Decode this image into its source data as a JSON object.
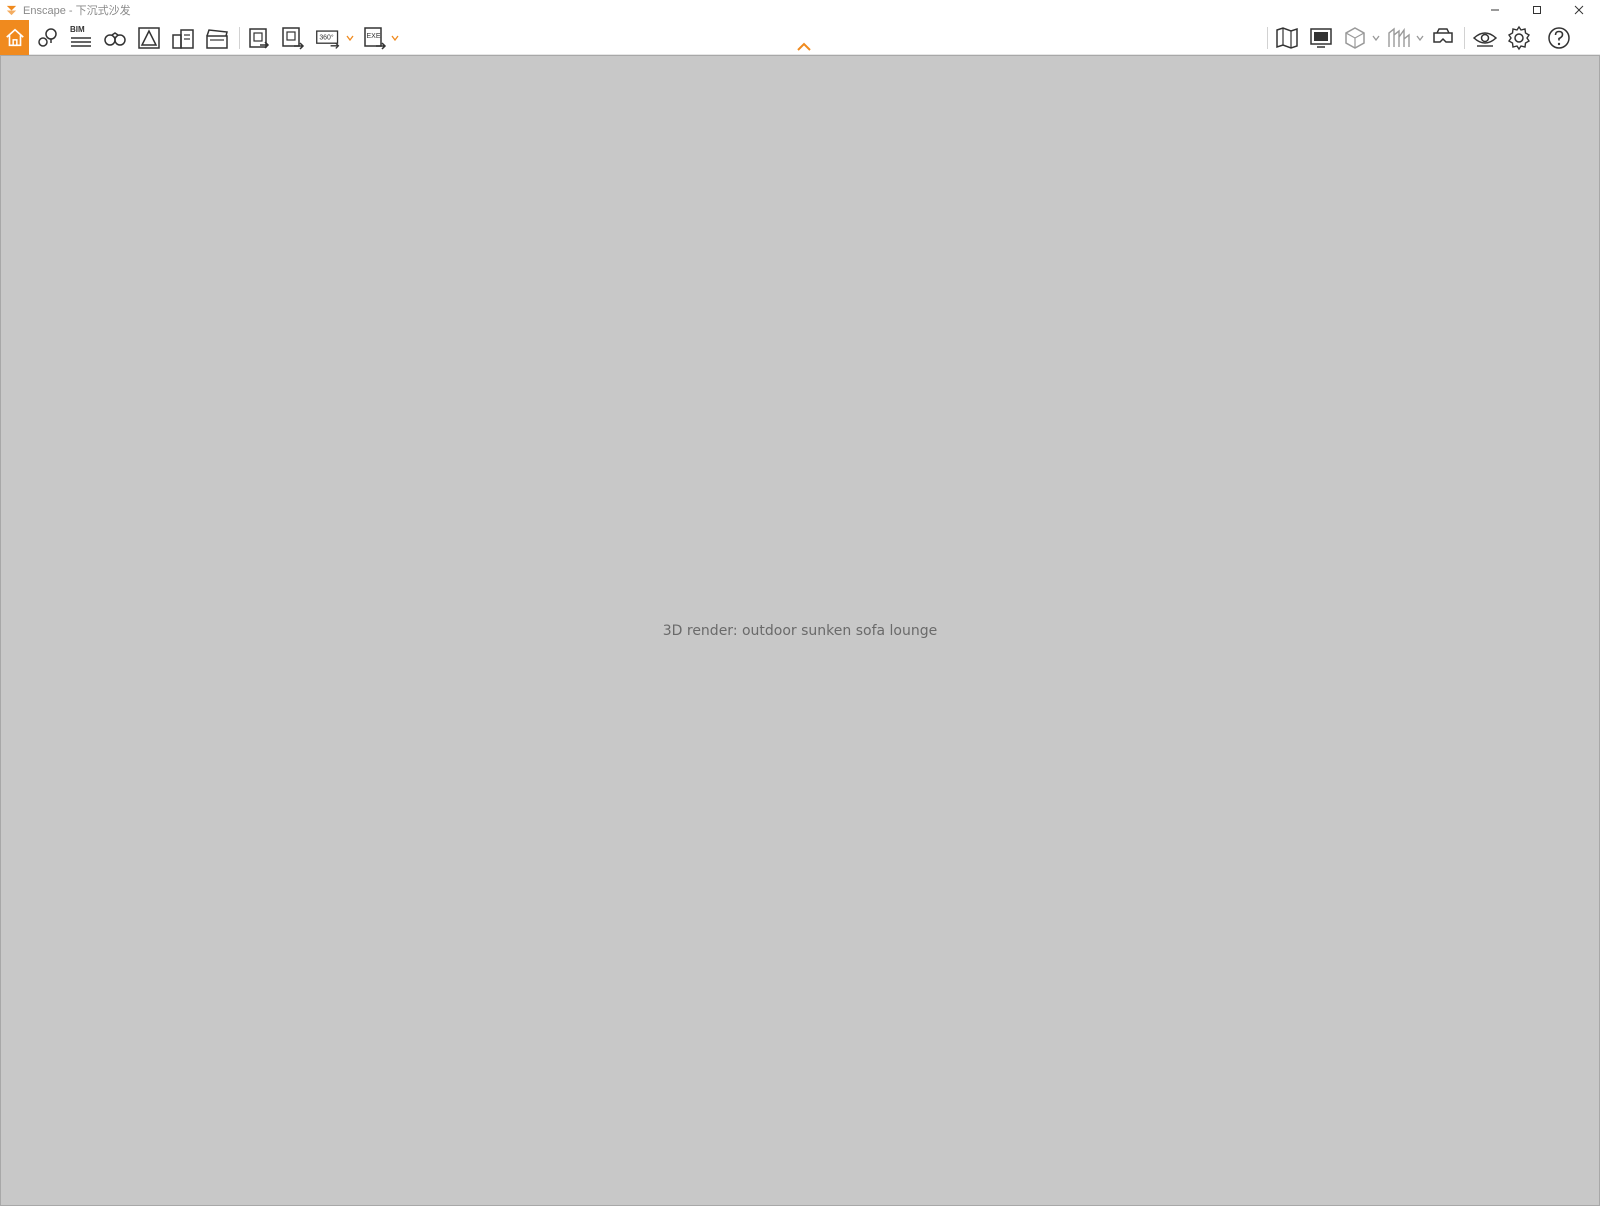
{
  "window": {
    "title": "Enscape - 下沉式沙发",
    "controls": [
      "minimize-icon",
      "maximize-icon",
      "close-icon"
    ]
  },
  "toolbar": {
    "accent_color": "#f08a1e",
    "bim_label": "BIM",
    "left_tools": [
      "home-icon",
      "location-pin-icon",
      "bim-list-icon",
      "binoculars-icon",
      "perspective-icon",
      "buildings-icon",
      "clapperboard-icon",
      "batch-render-icon",
      "panorama-export-icon",
      "panorama-360-icon",
      "exe-export-icon"
    ],
    "panorama_label": "360°",
    "exe_label": "EXE",
    "right_tools": [
      "map-icon",
      "monitor-icon",
      "cube-icon",
      "cityscape-icon",
      "vr-headset-icon",
      "eye-icon",
      "gear-icon",
      "help-icon"
    ]
  },
  "viewport": {
    "placeholder_label": "3D render: outdoor sunken sofa lounge"
  }
}
